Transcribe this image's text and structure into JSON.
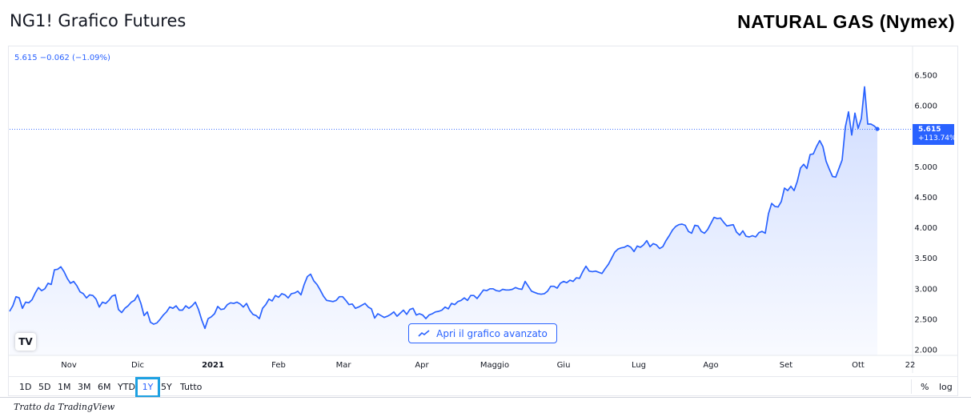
{
  "header": {
    "title": "NG1! Grafico Futures",
    "banner": "NATURAL GAS (Nymex)"
  },
  "quote": {
    "text": "5.615 −0.062 (−1.09%)"
  },
  "price_tag": {
    "value": "5.615",
    "change": "+113.74%"
  },
  "advanced_button": {
    "label": "Apri il grafico avanzato",
    "icon": "trend-line-icon"
  },
  "logo": {
    "text": "TV"
  },
  "ranges": [
    "1D",
    "5D",
    "1M",
    "3M",
    "6M",
    "YTD",
    "1Y",
    "5Y",
    "Tutto"
  ],
  "active_range": "1Y",
  "toolbar_right": {
    "percent": "%",
    "log": "log"
  },
  "footer": {
    "credit": "Tratto da TradingView"
  },
  "colors": {
    "line": "#2962ff",
    "accent": "#2962ff",
    "active_range_border": "#1da1e2"
  },
  "chart_data": {
    "type": "area",
    "title": "",
    "xlabel": "",
    "ylabel": "",
    "ylim": [
      1.9,
      6.9
    ],
    "y_ticks": [
      "2.000",
      "2.500",
      "3.000",
      "3.500",
      "4.000",
      "4.500",
      "5.000",
      "5.500",
      "6.000",
      "6.500"
    ],
    "x_ticks": [
      "Nov",
      "Dic",
      "2021",
      "Feb",
      "Mar",
      "Apr",
      "Maggio",
      "Giu",
      "Lug",
      "Ago",
      "Set",
      "Ott",
      "22"
    ],
    "last_value": 5.615,
    "grid": false,
    "series": [
      {
        "values": [
          2.63,
          2.72,
          2.87,
          2.85,
          2.68,
          2.78,
          2.77,
          2.82,
          2.93,
          3.02,
          2.97,
          3.0,
          3.09,
          3.07,
          3.31,
          3.32,
          3.36,
          3.28,
          3.17,
          3.09,
          3.12,
          3.05,
          2.95,
          2.92,
          2.85,
          2.9,
          2.89,
          2.83,
          2.7,
          2.78,
          2.76,
          2.81,
          2.88,
          2.9,
          2.66,
          2.61,
          2.68,
          2.72,
          2.78,
          2.81,
          2.9,
          2.76,
          2.56,
          2.62,
          2.45,
          2.42,
          2.44,
          2.5,
          2.57,
          2.62,
          2.7,
          2.68,
          2.72,
          2.65,
          2.65,
          2.72,
          2.68,
          2.72,
          2.78,
          2.66,
          2.49,
          2.35,
          2.51,
          2.54,
          2.59,
          2.71,
          2.66,
          2.67,
          2.74,
          2.77,
          2.76,
          2.78,
          2.75,
          2.7,
          2.76,
          2.65,
          2.58,
          2.56,
          2.51,
          2.68,
          2.74,
          2.83,
          2.8,
          2.89,
          2.86,
          2.92,
          2.9,
          2.85,
          2.92,
          2.93,
          2.96,
          2.9,
          3.07,
          3.2,
          3.24,
          3.13,
          3.07,
          2.98,
          2.88,
          2.81,
          2.8,
          2.79,
          2.81,
          2.87,
          2.87,
          2.81,
          2.74,
          2.75,
          2.68,
          2.7,
          2.73,
          2.76,
          2.7,
          2.67,
          2.52,
          2.59,
          2.56,
          2.53,
          2.55,
          2.58,
          2.62,
          2.55,
          2.6,
          2.65,
          2.58,
          2.66,
          2.68,
          2.57,
          2.59,
          2.57,
          2.51,
          2.57,
          2.59,
          2.62,
          2.63,
          2.65,
          2.7,
          2.67,
          2.76,
          2.74,
          2.79,
          2.81,
          2.85,
          2.81,
          2.89,
          2.89,
          2.84,
          2.91,
          2.98,
          2.97,
          3.0,
          3.0,
          2.97,
          2.96,
          2.99,
          2.98,
          2.98,
          2.99,
          3.02,
          3.0,
          2.99,
          3.12,
          3.04,
          2.96,
          2.94,
          2.92,
          2.91,
          2.92,
          2.96,
          3.04,
          3.04,
          3.01,
          3.09,
          3.12,
          3.1,
          3.14,
          3.12,
          3.18,
          3.17,
          3.28,
          3.37,
          3.29,
          3.28,
          3.29,
          3.27,
          3.25,
          3.33,
          3.4,
          3.5,
          3.6,
          3.65,
          3.67,
          3.68,
          3.71,
          3.68,
          3.61,
          3.7,
          3.68,
          3.72,
          3.79,
          3.69,
          3.74,
          3.72,
          3.66,
          3.69,
          3.79,
          3.87,
          3.96,
          4.02,
          4.05,
          4.06,
          4.04,
          3.94,
          3.91,
          4.04,
          4.03,
          3.94,
          3.91,
          3.97,
          4.07,
          4.17,
          4.15,
          4.16,
          4.09,
          4.03,
          4.04,
          4.05,
          3.93,
          3.88,
          3.95,
          3.86,
          3.85,
          3.87,
          3.85,
          3.92,
          3.94,
          3.91,
          4.23,
          4.4,
          4.35,
          4.34,
          4.43,
          4.65,
          4.61,
          4.68,
          4.61,
          4.76,
          4.98,
          5.04,
          4.97,
          5.2,
          5.21,
          5.33,
          5.43,
          5.33,
          5.09,
          4.96,
          4.84,
          4.83,
          4.97,
          5.11,
          5.65,
          5.9,
          5.52,
          5.88,
          5.63,
          5.79,
          6.31,
          5.7,
          5.7,
          5.67,
          5.62
        ]
      }
    ]
  }
}
